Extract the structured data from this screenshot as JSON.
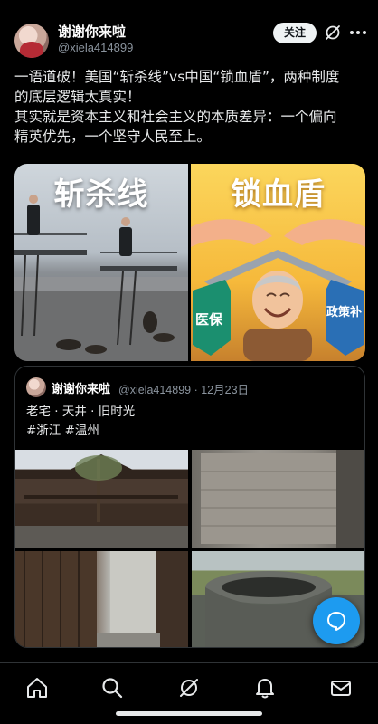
{
  "post": {
    "author_name": "谢谢你来啦",
    "author_handle": "@xiela414899",
    "follow_label": "关注",
    "text_lines": [
      "一语道破！美国“斩杀线”vs中国“锁血盾”，两种制度",
      "的底层逻辑太真实！",
      "其实就是资本主义和社会主义的本质差异：一个偏向",
      "精英优先，一个坚守人民至上。"
    ]
  },
  "media": {
    "left_image_text": "斩杀线",
    "right_image_text": "锁血盾",
    "right_badges": [
      "医保",
      "政策补"
    ]
  },
  "quote": {
    "author_name": "谢谢你来啦",
    "meta": "@xiela414899 · 12月23日",
    "text_line1": "老宅 · 天井 · 旧时光",
    "text_line2": "#浙江 #温州"
  },
  "icons": {
    "grok": "grok-icon",
    "more": "more-icon",
    "fab": "reply-bubble-icon",
    "tabs": [
      "home-icon",
      "search-icon",
      "grok-icon",
      "notifications-icon",
      "messages-icon"
    ]
  },
  "colors": {
    "background": "#000000",
    "accent": "#1d9bf0",
    "secondary_text": "#8b949e"
  }
}
